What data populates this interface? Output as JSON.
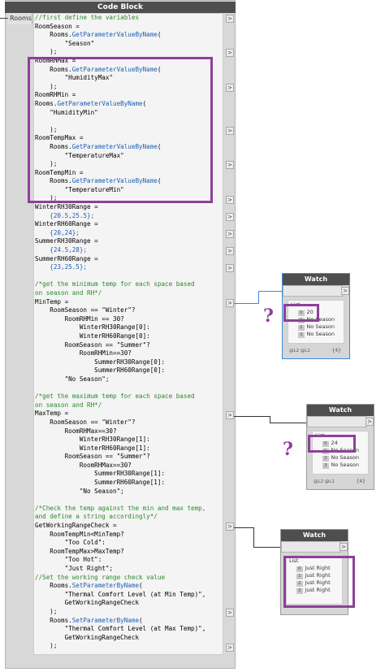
{
  "code_block": {
    "title": "Code Block",
    "input_port": "Rooms",
    "output_port_glyph": ">",
    "lines": [
      {
        "t": "//first define the variables",
        "c": "cm"
      },
      {
        "t": "RoomSeason =",
        "c": ""
      },
      {
        "t": "    Rooms.GetParameterValueByName(",
        "c": "call"
      },
      {
        "t": "        \"Season\"",
        "c": "str"
      },
      {
        "t": "    );",
        "c": ""
      },
      {
        "t": "RoomRHMax =",
        "c": ""
      },
      {
        "t": "    Rooms.GetParameterValueByName(",
        "c": "call"
      },
      {
        "t": "        \"HumidityMax\"",
        "c": "str"
      },
      {
        "t": "    );",
        "c": ""
      },
      {
        "t": "RoomRHMin =",
        "c": ""
      },
      {
        "t": "Rooms.GetParameterValueByName(",
        "c": "call"
      },
      {
        "t": "    \"HumidityMin\"",
        "c": "str"
      },
      {
        "t": "",
        "c": ""
      },
      {
        "t": "    );",
        "c": ""
      },
      {
        "t": "RoomTempMax =",
        "c": ""
      },
      {
        "t": "    Rooms.GetParameterValueByName(",
        "c": "call"
      },
      {
        "t": "        \"TemperatureMax\"",
        "c": "str"
      },
      {
        "t": "    );",
        "c": ""
      },
      {
        "t": "RoomTempMin =",
        "c": ""
      },
      {
        "t": "    Rooms.GetParameterValueByName(",
        "c": "call"
      },
      {
        "t": "        \"TemperatureMin\"",
        "c": "str"
      },
      {
        "t": "    );",
        "c": ""
      },
      {
        "t": "WinterRH30Range =",
        "c": ""
      },
      {
        "t": "    {20.5,25.5};",
        "c": "num"
      },
      {
        "t": "WinterRH60Range =",
        "c": ""
      },
      {
        "t": "    {20,24};",
        "c": "num"
      },
      {
        "t": "SummerRH30Range =",
        "c": ""
      },
      {
        "t": "    {24.5,28};",
        "c": "num"
      },
      {
        "t": "SummerRH60Range =",
        "c": ""
      },
      {
        "t": "    {23,25.5};",
        "c": "num"
      },
      {
        "t": "",
        "c": ""
      },
      {
        "t": "/*get the minimum temp for each space based",
        "c": "cm"
      },
      {
        "t": "on season and RH*/",
        "c": "cm"
      },
      {
        "t": "MinTemp =",
        "c": ""
      },
      {
        "t": "    RoomSeason == \"Winter\"?",
        "c": ""
      },
      {
        "t": "        RoomRHMin == 30?",
        "c": ""
      },
      {
        "t": "            WinterRH30Range[0]:",
        "c": ""
      },
      {
        "t": "            WinterRH60Range[0]:",
        "c": ""
      },
      {
        "t": "        RoomSeason == \"Summer\"?",
        "c": ""
      },
      {
        "t": "            RoomRHMin==30?",
        "c": ""
      },
      {
        "t": "                SummerRH30Range[0]:",
        "c": ""
      },
      {
        "t": "                SummerRH60Range[0]:",
        "c": ""
      },
      {
        "t": "        \"No Season\";",
        "c": ""
      },
      {
        "t": "",
        "c": ""
      },
      {
        "t": "/*get the maximum temp for each space based",
        "c": "cm"
      },
      {
        "t": "on season and RH*/",
        "c": "cm"
      },
      {
        "t": "MaxTemp =",
        "c": ""
      },
      {
        "t": "    RoomSeason == \"Winter\"?",
        "c": ""
      },
      {
        "t": "        RoomRHMax==30?",
        "c": ""
      },
      {
        "t": "            WinterRH30Range[1]:",
        "c": ""
      },
      {
        "t": "            WinterRH60Range[1]:",
        "c": ""
      },
      {
        "t": "        RoomSeason == \"Summer\"?",
        "c": ""
      },
      {
        "t": "            RoomRHMax==30?",
        "c": ""
      },
      {
        "t": "                SummerRH30Range[1]:",
        "c": ""
      },
      {
        "t": "                SummerRH60Range[1]:",
        "c": ""
      },
      {
        "t": "            \"No Season\";",
        "c": ""
      },
      {
        "t": "",
        "c": ""
      },
      {
        "t": "/*Check the temp against the min and max temp,",
        "c": "cm"
      },
      {
        "t": "and define a string accordingly*/",
        "c": "cm"
      },
      {
        "t": "GetWorkingRangeCheck =",
        "c": ""
      },
      {
        "t": "    RoomTempMin<MinTemp?",
        "c": ""
      },
      {
        "t": "        \"Too Cold\":",
        "c": ""
      },
      {
        "t": "    RoomTempMax>MaxTemp?",
        "c": ""
      },
      {
        "t": "        \"Too Hot\":",
        "c": ""
      },
      {
        "t": "        \"Just Right\";",
        "c": ""
      },
      {
        "t": "//Set the working range check value",
        "c": "cm"
      },
      {
        "t": "    Rooms.SetParameterByName(",
        "c": "call"
      },
      {
        "t": "        \"Thermal Comfort Level (at Min Temp)\",",
        "c": ""
      },
      {
        "t": "        GetWorkingRangeCheck",
        "c": ""
      },
      {
        "t": "    );",
        "c": ""
      },
      {
        "t": "    Rooms.SetParameterByName(",
        "c": "call"
      },
      {
        "t": "        \"Thermal Comfort Level (at Max Temp)\",",
        "c": ""
      },
      {
        "t": "        GetWorkingRangeCheck",
        "c": ""
      },
      {
        "t": "    );",
        "c": ""
      }
    ]
  },
  "watch_nodes": [
    {
      "title": "Watch",
      "list_label": "List",
      "items": [
        {
          "index": "0",
          "value": "20"
        },
        {
          "index": "1",
          "value": "No Season"
        },
        {
          "index": "2",
          "value": "No Season"
        },
        {
          "index": "3",
          "value": "No Season"
        }
      ],
      "footer_left": "@L2 @L1",
      "footer_right": "{4}",
      "annotation": "?"
    },
    {
      "title": "Watch",
      "list_label": "List",
      "items": [
        {
          "index": "0",
          "value": "24"
        },
        {
          "index": "1",
          "value": "No Season"
        },
        {
          "index": "2",
          "value": "No Season"
        },
        {
          "index": "3",
          "value": "No Season"
        }
      ],
      "footer_left": "@L2 @L1",
      "footer_right": "{4}",
      "annotation": "?"
    },
    {
      "title": "Watch",
      "list_label": "List",
      "items": [
        {
          "index": "0",
          "value": "Just Right"
        },
        {
          "index": "1",
          "value": "Just Right"
        },
        {
          "index": "2",
          "value": "Just Right"
        },
        {
          "index": "3",
          "value": "Just Right"
        }
      ],
      "footer_left": "",
      "footer_right": "",
      "annotation": ""
    }
  ],
  "colors": {
    "highlight": "#8e3f9a",
    "header": "#4e4e4e",
    "keyword": "#1a5fb4",
    "comment": "#2a8a2a",
    "wire_selected": "#3b8ad8"
  }
}
